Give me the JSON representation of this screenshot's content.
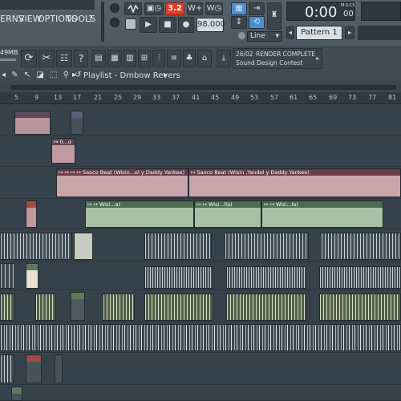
{
  "menu": {
    "patterns": "ERNS",
    "view": "VIEW",
    "options": "OPTIONS",
    "tools": "TOOLS",
    "help": "?"
  },
  "transport": {
    "pattern_song_value": "3.2",
    "tempo": "98.000",
    "time": "0:00",
    "time_small": "00",
    "time_unit": "M:S:CS",
    "pattern": "Pattern 1",
    "snap": "Line"
  },
  "memory": {
    "value": "49",
    "unit": "MB"
  },
  "hint": {
    "date": "26/02",
    "title": "RENDER COMPLETE",
    "subtitle": "Sound Design Contest"
  },
  "playlist": {
    "title": "Playlist - Dmbow Revers",
    "arrow": "▸"
  },
  "ruler": [
    "5",
    "9",
    "13",
    "17",
    "21",
    "25",
    "29",
    "33",
    "37",
    "41",
    "45",
    "49",
    "53",
    "57",
    "61",
    "65",
    "69",
    "73",
    "77",
    "81"
  ],
  "clips": {
    "track3_label_a": "↦ ↦ ↦ ↦ Saoco Beat (Wisin...el y Daddy Yankee)",
    "track3_label_b": "↦ Saoco Beat (Wisin ,Yandel y Daddy Yankee)",
    "track4_label_a": "↦ ↦ Wisi...a)",
    "track4_label_b": "↦ ↦ Wisi...lla)",
    "track4_label_c": "↦ ↦ Wisi...la)",
    "track2_label": "↦ 0...o"
  },
  "colors": {
    "accent": "#f05a3c",
    "blue": "#4a90d6",
    "pink_clip": "#b9949a",
    "green_clip": "#8aa487",
    "dark_clip": "#5d6d79"
  }
}
